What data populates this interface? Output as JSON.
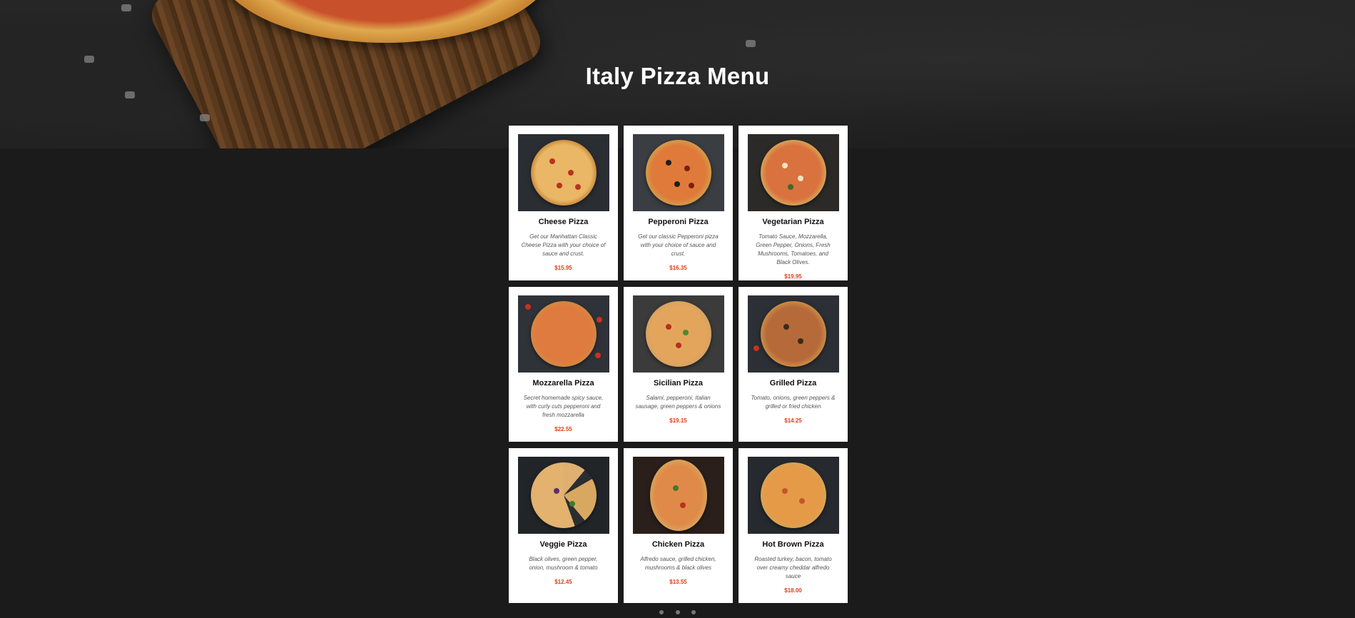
{
  "page": {
    "title": "Italy Pizza Menu"
  },
  "colors": {
    "price": "#e0401a",
    "background": "#1b1b1b",
    "card": "#ffffff"
  },
  "menu": {
    "items": [
      {
        "name": "Cheese Pizza",
        "description": "Get our Manhattan Classic Cheese Pizza with your choice of sauce and crust.",
        "price": "$15.95",
        "image": "cheese-pizza-photo"
      },
      {
        "name": "Pepperoni Pizza",
        "description": "Get our classic Pepperoni pizza with your choice of sauce and crust.",
        "price": "$16.35",
        "image": "pepperoni-pizza-photo"
      },
      {
        "name": "Vegetarian Pizza",
        "description": "Tomato Sauce, Mozzarella, Green Pepper, Onions, Fresh Mushrooms, Tomatoes, and Black Olives.",
        "price": "$19.95",
        "image": "vegetarian-pizza-photo"
      },
      {
        "name": "Mozzarella Pizza",
        "description": "Secret homemade spicy sauce, with curly cuts pepperoni and fresh mozzarella",
        "price": "$22.55",
        "image": "mozzarella-pizza-photo"
      },
      {
        "name": "Sicilian Pizza",
        "description": "Salami, pepperoni, Italian sausage, green peppers & onions",
        "price": "$19.15",
        "image": "sicilian-pizza-photo"
      },
      {
        "name": "Grilled Pizza",
        "description": "Tomato, onions, green peppers & grilled or fried chicken",
        "price": "$14.25",
        "image": "grilled-pizza-photo"
      },
      {
        "name": "Veggie Pizza",
        "description": "Black olives, green pepper, onion, mushroom & tomato",
        "price": "$12.45",
        "image": "veggie-pizza-photo"
      },
      {
        "name": "Chicken Pizza",
        "description": "Alfredo sauce, grilled chicken, mushrooms & black olives",
        "price": "$13.55",
        "image": "chicken-pizza-photo"
      },
      {
        "name": "Hot Brown Pizza",
        "description": "Roasted turkey, bacon, tomato over creamy cheddar alfredo sauce",
        "price": "$18.00",
        "image": "hot-brown-pizza-photo"
      }
    ]
  }
}
